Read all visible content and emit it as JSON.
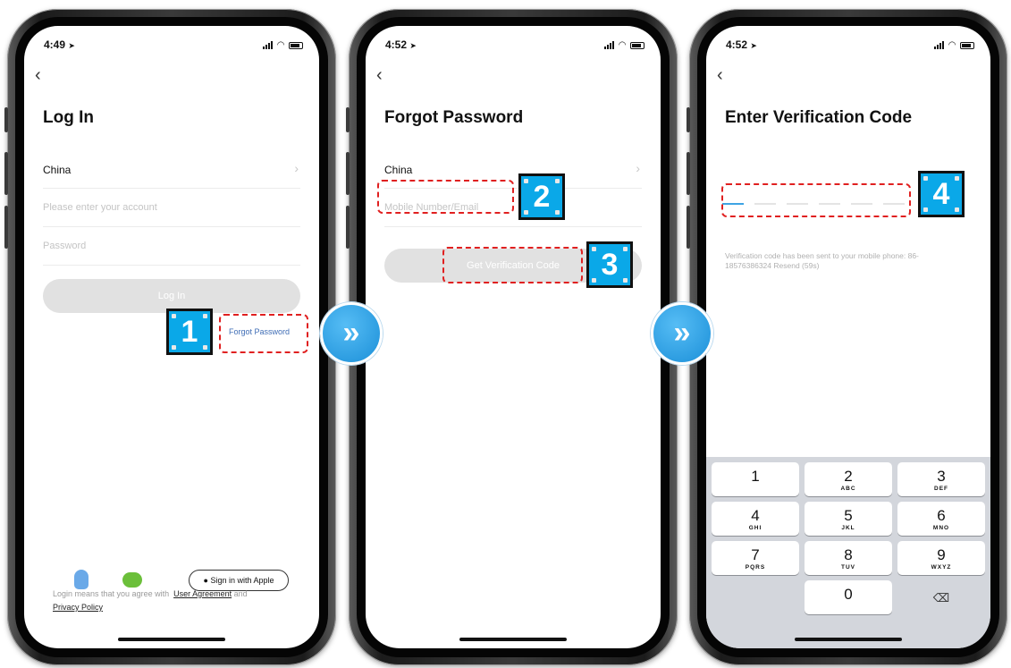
{
  "screen1": {
    "status_time": "4:49",
    "title": "Log In",
    "country": "China",
    "account_placeholder": "Please enter your account",
    "password_placeholder": "Password",
    "login_button": "Log In",
    "forgot_password": "Forgot Password",
    "apple_button": "Sign in with Apple",
    "legal_prefix": "Login means that you agree with",
    "user_agreement": "User Agreement",
    "legal_and": "and",
    "privacy_policy": "Privacy Policy",
    "callout": "1"
  },
  "screen2": {
    "status_time": "4:52",
    "title": "Forgot Password",
    "country": "China",
    "contact_placeholder": "Mobile Number/Email",
    "get_code_button": "Get Verification Code",
    "callout_field": "2",
    "callout_button": "3"
  },
  "screen3": {
    "status_time": "4:52",
    "title": "Enter Verification Code",
    "sent_message": "Verification code has been sent to your mobile phone: 86-18576386324",
    "resend": "Resend (59s)",
    "callout": "4",
    "keypad": [
      [
        {
          "d": "1",
          "l": ""
        },
        {
          "d": "2",
          "l": "ABC"
        },
        {
          "d": "3",
          "l": "DEF"
        }
      ],
      [
        {
          "d": "4",
          "l": "GHI"
        },
        {
          "d": "5",
          "l": "JKL"
        },
        {
          "d": "6",
          "l": "MNO"
        }
      ],
      [
        {
          "d": "7",
          "l": "PQRS"
        },
        {
          "d": "8",
          "l": "TUV"
        },
        {
          "d": "9",
          "l": "WXYZ"
        }
      ],
      [
        {
          "d": "",
          "l": ""
        },
        {
          "d": "0",
          "l": ""
        },
        {
          "d": "⌫",
          "l": ""
        }
      ]
    ]
  },
  "arrows": [
    "»",
    "»"
  ],
  "colors": {
    "callout_fill": "#0aa8e8",
    "highlight_dash": "#e02020",
    "arrow_fill": "#2f9fe6",
    "link_blue": "#3f6db5",
    "button_disabled": "#e1e1e1"
  },
  "icons": [
    "back-chevron-icon",
    "location-arrow-icon",
    "signal-icon",
    "wifi-icon",
    "battery-icon",
    "qq-penguin-icon",
    "wechat-icon",
    "apple-icon",
    "backspace-icon",
    "double-chevron-right-icon"
  ]
}
